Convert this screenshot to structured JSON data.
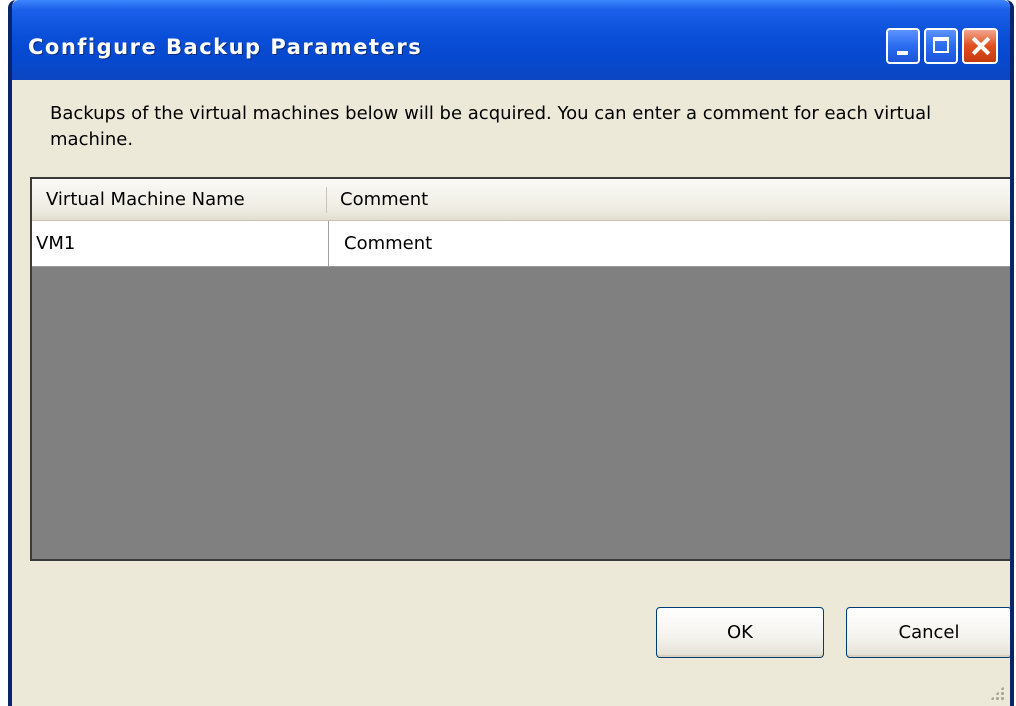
{
  "window": {
    "title": "Configure Backup Parameters",
    "controls": [
      "minimize-icon",
      "maximize-icon",
      "close-icon"
    ]
  },
  "description": "Backups of the virtual machines below will be acquired. You can enter a comment for each virtual machine.",
  "table": {
    "columns": [
      "Virtual Machine Name",
      "Comment"
    ],
    "rows": [
      {
        "name": "VM1",
        "comment": "Comment"
      }
    ]
  },
  "buttons": {
    "ok": "OK",
    "cancel": "Cancel"
  },
  "colors": {
    "titlebar": "#0a4fd8",
    "close_button": "#e0501f",
    "dialog_background": "#ece9d8",
    "grid_background": "#808080"
  }
}
